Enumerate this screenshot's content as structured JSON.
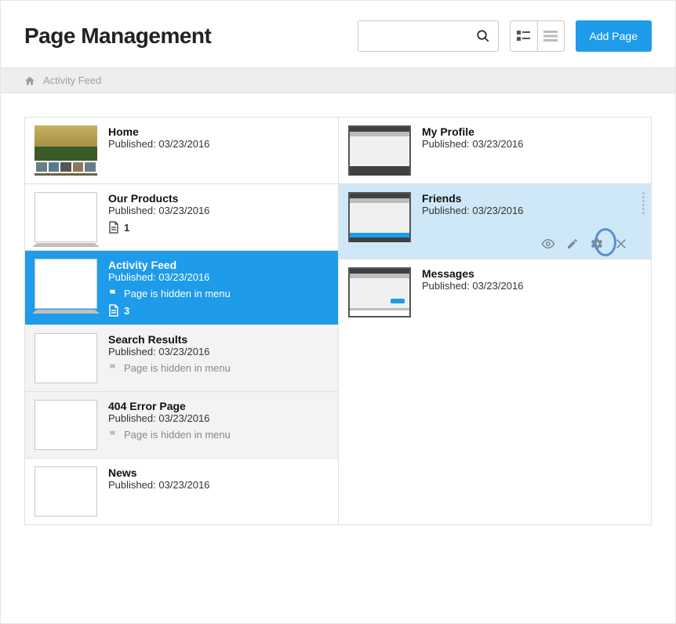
{
  "header": {
    "title": "Page Management",
    "search_placeholder": "",
    "add_button_label": "Add Page"
  },
  "breadcrumb": {
    "label": "Activity Feed"
  },
  "labels": {
    "published": "Published:",
    "hidden_in_menu": "Page is hidden in menu"
  },
  "pages": {
    "home": {
      "name": "Home",
      "published": "03/23/2016"
    },
    "our_products": {
      "name": "Our Products",
      "published": "03/23/2016",
      "child_count": "1"
    },
    "activity_feed": {
      "name": "Activity Feed",
      "published": "03/23/2016",
      "child_count": "3"
    },
    "search_results": {
      "name": "Search Results",
      "published": "03/23/2016"
    },
    "error_404": {
      "name": "404 Error Page",
      "published": "03/23/2016"
    },
    "news": {
      "name": "News",
      "published": "03/23/2016"
    },
    "my_profile": {
      "name": "My Profile",
      "published": "03/23/2016"
    },
    "friends": {
      "name": "Friends",
      "published": "03/23/2016"
    },
    "messages": {
      "name": "Messages",
      "published": "03/23/2016"
    }
  }
}
